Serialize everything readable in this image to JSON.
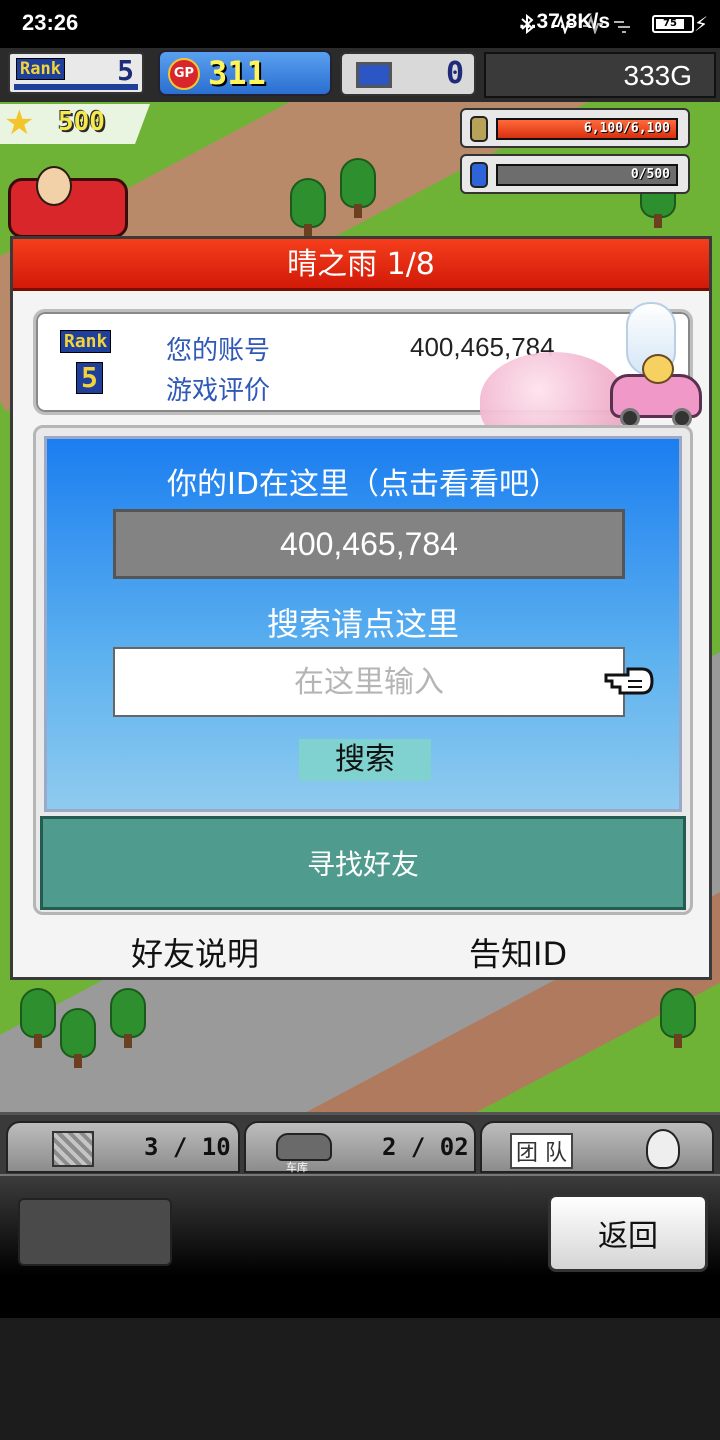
{
  "status_bar": {
    "time": "23:26",
    "net_speed": "...37.8K/s",
    "battery": "75"
  },
  "hud": {
    "rank_label": "Rank",
    "rank_value": "5",
    "gp_icon": "GP",
    "gp_value": "311",
    "pc_value": "0",
    "money": "333G",
    "stars": "500",
    "resource1": {
      "text": "6,100/6,100",
      "level": 1.0
    },
    "resource2": {
      "text": "0/500",
      "level": 0.0
    }
  },
  "dialog": {
    "title": "晴之雨 1/8",
    "profile": {
      "rank_label": "Rank",
      "rank_value": "5",
      "account_label": "您的账号",
      "rating_label": "游戏评价",
      "account_value": "400,465,784"
    },
    "search": {
      "id_title": "你的ID在这里（点击看看吧）",
      "id_value": "400,465,784",
      "search_title": "搜索请点这里",
      "input_placeholder": "在这里输入",
      "search_button": "搜索",
      "find_friends_button": "寻找好友"
    },
    "links": {
      "friend_info": "好友说明",
      "notify_id": "告知ID"
    }
  },
  "bottom_tabs": {
    "items_count": "3 / 10",
    "garage_count": "2 / 02",
    "garage_label": "车库",
    "team_label": "团 队"
  },
  "bottom_panel": {
    "back_button": "返回"
  },
  "icons": [
    "signal-icon",
    "bluetooth-icon",
    "battery-icon",
    "star-icon",
    "coin-icon",
    "fuel-icon",
    "pc-icon",
    "hand-pointer-icon",
    "box-icon",
    "car-icon",
    "face-icon"
  ]
}
